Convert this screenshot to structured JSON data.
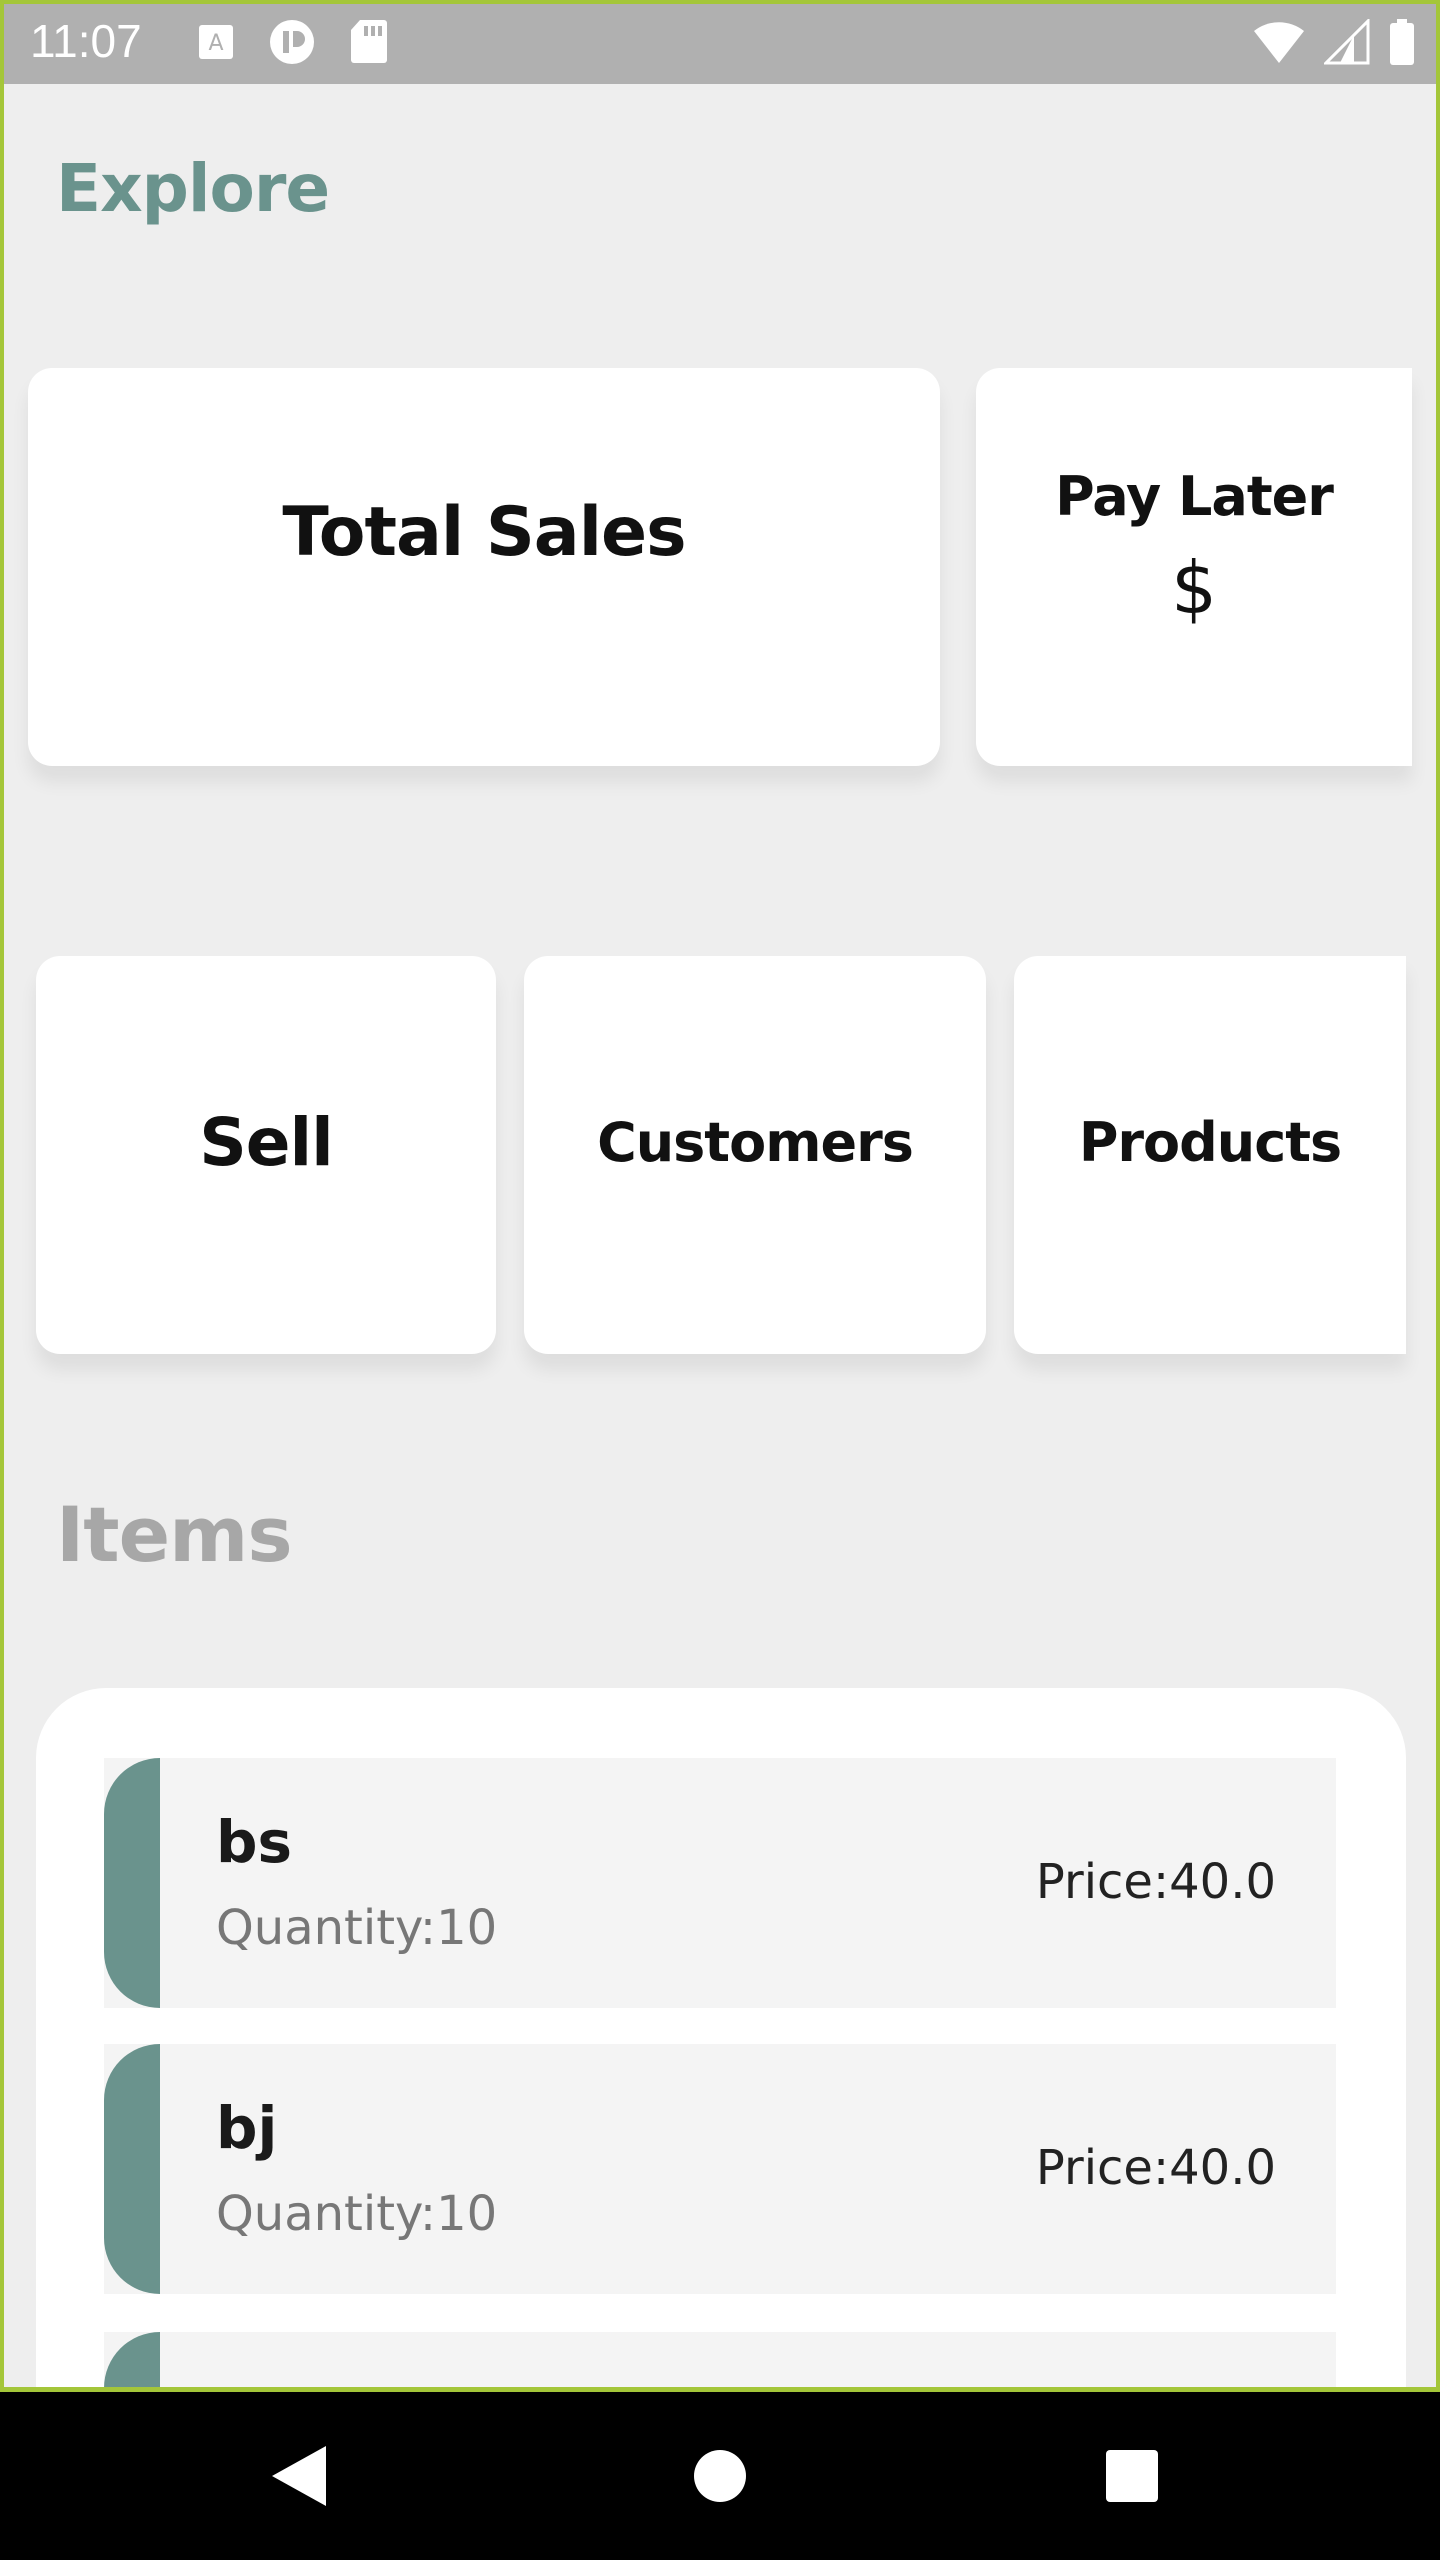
{
  "status_bar": {
    "time": "11:07",
    "icons_left": [
      "font-download-icon",
      "vpn-circle-icon",
      "sd-card-icon"
    ],
    "icons_right": [
      "wifi-icon",
      "cell-signal-icon",
      "battery-icon"
    ]
  },
  "explore": {
    "title": "Explore"
  },
  "cards": {
    "total_sales": {
      "label": "Total Sales"
    },
    "pay_later": {
      "label": "Pay Later",
      "value": "$"
    },
    "sell": {
      "label": "Sell"
    },
    "customers": {
      "label": "Customers"
    },
    "products": {
      "label": "Products"
    }
  },
  "items": {
    "title": "Items",
    "list": [
      {
        "name": "bs",
        "quantity": "Quantity:10",
        "price": "Price:40.0"
      },
      {
        "name": "bj",
        "quantity": "Quantity:10",
        "price": "Price:40.0"
      },
      {
        "name": "",
        "quantity": "",
        "price": ""
      }
    ]
  },
  "nav_bar": {
    "buttons": [
      "back-icon",
      "home-icon",
      "recents-icon"
    ]
  },
  "colors": {
    "accent": "#6a938d",
    "status_bar": "#b0b0b0",
    "background": "#eeeeee",
    "frame": "#a4c639"
  }
}
